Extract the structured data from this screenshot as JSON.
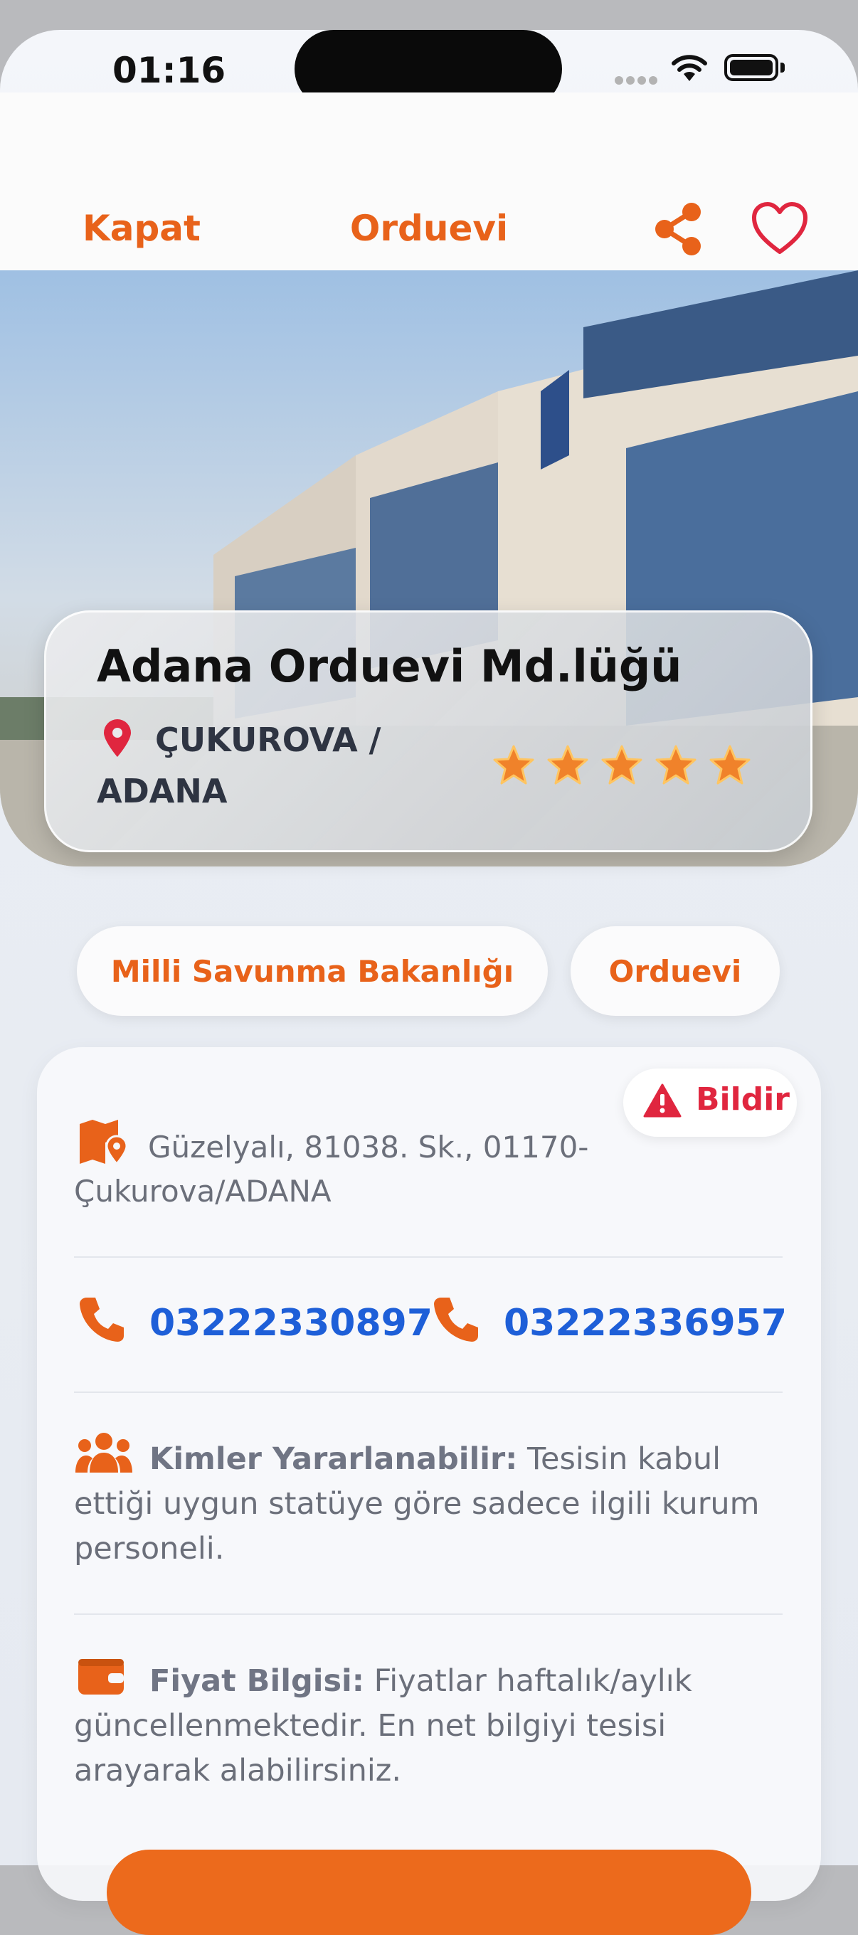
{
  "status_bar": {
    "time": "01:16"
  },
  "nav": {
    "close_label": "Kapat",
    "title": "Orduevi"
  },
  "hero": {
    "name": "Adana Orduevi Md.lüğü",
    "location": "ÇUKUROVA / ADANA",
    "rating": 5,
    "rating_max": 5
  },
  "tags": [
    "Milli Savunma Bakanlığı",
    "Orduevi"
  ],
  "info": {
    "report_label": "Bildir",
    "address": "Güzelyalı, 81038. Sk., 01170-Çukurova/ADANA",
    "phones": [
      "03222330897",
      "03222336957"
    ],
    "eligibility_label": "Kimler Yararlanabilir:",
    "eligibility_text": " Tesisin kabul ettiği uygun statüye göre sadece ilgili kurum personeli.",
    "price_label": "Fiyat Bilgisi:",
    "price_text": " Fiyatlar haftalık/aylık güncellenmektedir. En net bilgiyi tesisi arayarak alabilirsiniz."
  },
  "colors": {
    "accent": "#e8621a",
    "link": "#1e5fd8",
    "alert": "#e0263f"
  },
  "icons": [
    "share-icon",
    "heart-icon",
    "location-pin-icon",
    "star-icon",
    "warning-icon",
    "map-icon",
    "phone-icon",
    "users-icon",
    "wallet-icon"
  ]
}
